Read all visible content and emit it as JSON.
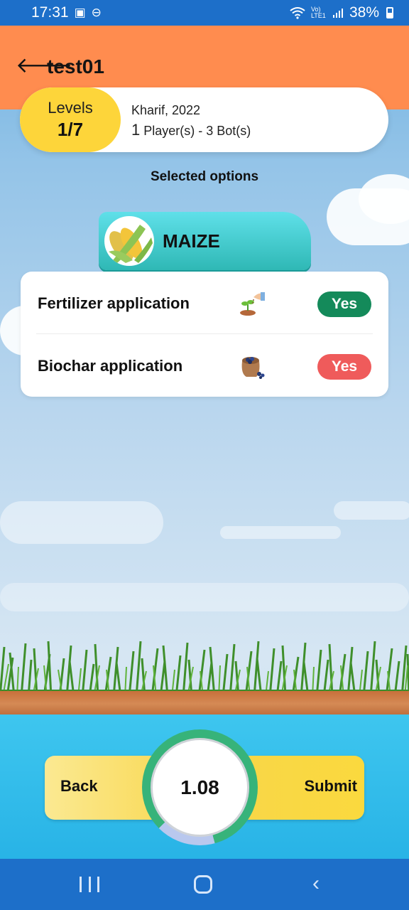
{
  "status_bar": {
    "time": "17:31",
    "network": "Vo) LTE1",
    "battery": "38%"
  },
  "header": {
    "title": "test01"
  },
  "game_info": {
    "levels_label": "Levels",
    "levels_value": "1/7",
    "season": "Kharif, 2022",
    "player_count": "1",
    "players_text": "Player(s)  - 3 Bot(s)"
  },
  "selected_title": "Selected options",
  "crop": {
    "name": "MAIZE"
  },
  "options": [
    {
      "label": "Fertilizer application",
      "value": "Yes",
      "badge_color": "#148a5a",
      "icon": "seedling-hand-icon"
    },
    {
      "label": "Biochar application",
      "value": "Yes",
      "badge_color": "#ef5b5b",
      "icon": "biochar-sack-icon"
    }
  ],
  "controls": {
    "back_label": "Back",
    "submit_label": "Submit",
    "timer_value": "1.08"
  },
  "colors": {
    "header": "#ff8c4f",
    "levels_pill": "#fdd53a",
    "crop_tag": "#2fb8b5",
    "system_bar": "#1d6fc9"
  }
}
